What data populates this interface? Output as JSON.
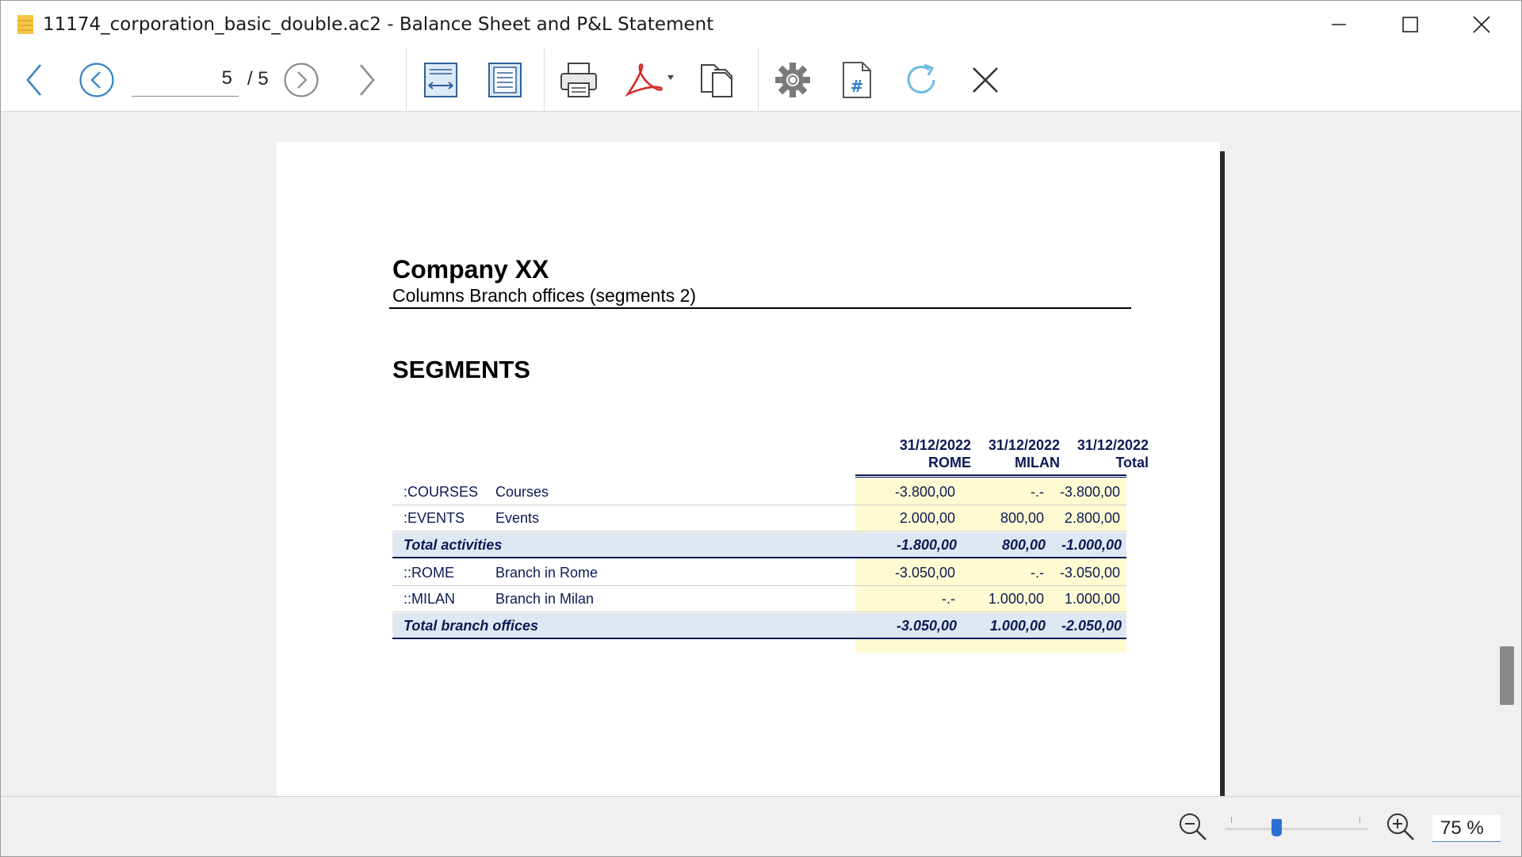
{
  "window": {
    "title": "11174_corporation_basic_double.ac2 - Balance Sheet and P&L Statement"
  },
  "toolbar": {
    "current_page": "5",
    "total_pages": "/ 5"
  },
  "report": {
    "company": "Company XX",
    "subtitle": "Columns Branch offices (segments 2)",
    "section_title": "SEGMENTS",
    "columns": [
      {
        "date": "31/12/2022",
        "name": "ROME"
      },
      {
        "date": "31/12/2022",
        "name": "MILAN"
      },
      {
        "date": "31/12/2022",
        "name": "Total"
      }
    ],
    "rows": [
      {
        "code": ":COURSES",
        "desc": "Courses",
        "rome": "-3.800,00",
        "milan": "-.-",
        "total": "-3.800,00"
      },
      {
        "code": ":EVENTS",
        "desc": "Events",
        "rome": "2.000,00",
        "milan": "800,00",
        "total": "2.800,00"
      },
      {
        "code": "Total activities",
        "desc": "",
        "rome": "-1.800,00",
        "milan": "800,00",
        "total": "-1.000,00"
      },
      {
        "code": "::ROME",
        "desc": "Branch in Rome",
        "rome": "-3.050,00",
        "milan": "-.-",
        "total": "-3.050,00"
      },
      {
        "code": "::MILAN",
        "desc": "Branch in Milan",
        "rome": "-.-",
        "milan": "1.000,00",
        "total": "1.000,00"
      },
      {
        "code": "Total branch offices",
        "desc": "",
        "rome": "-3.050,00",
        "milan": "1.000,00",
        "total": "-2.050,00"
      }
    ]
  },
  "statusbar": {
    "zoom": "75  %",
    "zoom_percent": 75
  },
  "colors": {
    "accent": "#2d6fd6",
    "pdf_red": "#d22b2b",
    "table_text": "#0d1a55",
    "amount_bg": "#fffad2",
    "total_bg": "#dfe8f2"
  }
}
